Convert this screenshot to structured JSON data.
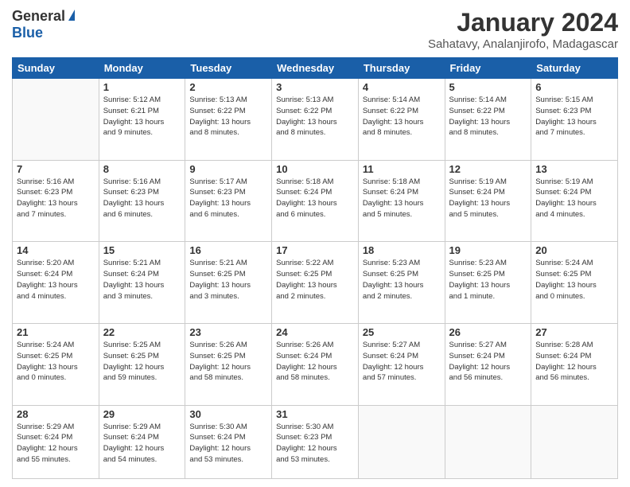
{
  "logo": {
    "general": "General",
    "blue": "Blue"
  },
  "header": {
    "month": "January 2024",
    "location": "Sahatavy, Analanjirofo, Madagascar"
  },
  "days_of_week": [
    "Sunday",
    "Monday",
    "Tuesday",
    "Wednesday",
    "Thursday",
    "Friday",
    "Saturday"
  ],
  "weeks": [
    [
      {
        "day": "",
        "info": ""
      },
      {
        "day": "1",
        "info": "Sunrise: 5:12 AM\nSunset: 6:21 PM\nDaylight: 13 hours\nand 9 minutes."
      },
      {
        "day": "2",
        "info": "Sunrise: 5:13 AM\nSunset: 6:22 PM\nDaylight: 13 hours\nand 8 minutes."
      },
      {
        "day": "3",
        "info": "Sunrise: 5:13 AM\nSunset: 6:22 PM\nDaylight: 13 hours\nand 8 minutes."
      },
      {
        "day": "4",
        "info": "Sunrise: 5:14 AM\nSunset: 6:22 PM\nDaylight: 13 hours\nand 8 minutes."
      },
      {
        "day": "5",
        "info": "Sunrise: 5:14 AM\nSunset: 6:22 PM\nDaylight: 13 hours\nand 8 minutes."
      },
      {
        "day": "6",
        "info": "Sunrise: 5:15 AM\nSunset: 6:23 PM\nDaylight: 13 hours\nand 7 minutes."
      }
    ],
    [
      {
        "day": "7",
        "info": "Sunrise: 5:16 AM\nSunset: 6:23 PM\nDaylight: 13 hours\nand 7 minutes."
      },
      {
        "day": "8",
        "info": "Sunrise: 5:16 AM\nSunset: 6:23 PM\nDaylight: 13 hours\nand 6 minutes."
      },
      {
        "day": "9",
        "info": "Sunrise: 5:17 AM\nSunset: 6:23 PM\nDaylight: 13 hours\nand 6 minutes."
      },
      {
        "day": "10",
        "info": "Sunrise: 5:18 AM\nSunset: 6:24 PM\nDaylight: 13 hours\nand 6 minutes."
      },
      {
        "day": "11",
        "info": "Sunrise: 5:18 AM\nSunset: 6:24 PM\nDaylight: 13 hours\nand 5 minutes."
      },
      {
        "day": "12",
        "info": "Sunrise: 5:19 AM\nSunset: 6:24 PM\nDaylight: 13 hours\nand 5 minutes."
      },
      {
        "day": "13",
        "info": "Sunrise: 5:19 AM\nSunset: 6:24 PM\nDaylight: 13 hours\nand 4 minutes."
      }
    ],
    [
      {
        "day": "14",
        "info": "Sunrise: 5:20 AM\nSunset: 6:24 PM\nDaylight: 13 hours\nand 4 minutes."
      },
      {
        "day": "15",
        "info": "Sunrise: 5:21 AM\nSunset: 6:24 PM\nDaylight: 13 hours\nand 3 minutes."
      },
      {
        "day": "16",
        "info": "Sunrise: 5:21 AM\nSunset: 6:25 PM\nDaylight: 13 hours\nand 3 minutes."
      },
      {
        "day": "17",
        "info": "Sunrise: 5:22 AM\nSunset: 6:25 PM\nDaylight: 13 hours\nand 2 minutes."
      },
      {
        "day": "18",
        "info": "Sunrise: 5:23 AM\nSunset: 6:25 PM\nDaylight: 13 hours\nand 2 minutes."
      },
      {
        "day": "19",
        "info": "Sunrise: 5:23 AM\nSunset: 6:25 PM\nDaylight: 13 hours\nand 1 minute."
      },
      {
        "day": "20",
        "info": "Sunrise: 5:24 AM\nSunset: 6:25 PM\nDaylight: 13 hours\nand 0 minutes."
      }
    ],
    [
      {
        "day": "21",
        "info": "Sunrise: 5:24 AM\nSunset: 6:25 PM\nDaylight: 13 hours\nand 0 minutes."
      },
      {
        "day": "22",
        "info": "Sunrise: 5:25 AM\nSunset: 6:25 PM\nDaylight: 12 hours\nand 59 minutes."
      },
      {
        "day": "23",
        "info": "Sunrise: 5:26 AM\nSunset: 6:25 PM\nDaylight: 12 hours\nand 58 minutes."
      },
      {
        "day": "24",
        "info": "Sunrise: 5:26 AM\nSunset: 6:24 PM\nDaylight: 12 hours\nand 58 minutes."
      },
      {
        "day": "25",
        "info": "Sunrise: 5:27 AM\nSunset: 6:24 PM\nDaylight: 12 hours\nand 57 minutes."
      },
      {
        "day": "26",
        "info": "Sunrise: 5:27 AM\nSunset: 6:24 PM\nDaylight: 12 hours\nand 56 minutes."
      },
      {
        "day": "27",
        "info": "Sunrise: 5:28 AM\nSunset: 6:24 PM\nDaylight: 12 hours\nand 56 minutes."
      }
    ],
    [
      {
        "day": "28",
        "info": "Sunrise: 5:29 AM\nSunset: 6:24 PM\nDaylight: 12 hours\nand 55 minutes."
      },
      {
        "day": "29",
        "info": "Sunrise: 5:29 AM\nSunset: 6:24 PM\nDaylight: 12 hours\nand 54 minutes."
      },
      {
        "day": "30",
        "info": "Sunrise: 5:30 AM\nSunset: 6:24 PM\nDaylight: 12 hours\nand 53 minutes."
      },
      {
        "day": "31",
        "info": "Sunrise: 5:30 AM\nSunset: 6:23 PM\nDaylight: 12 hours\nand 53 minutes."
      },
      {
        "day": "",
        "info": ""
      },
      {
        "day": "",
        "info": ""
      },
      {
        "day": "",
        "info": ""
      }
    ]
  ]
}
